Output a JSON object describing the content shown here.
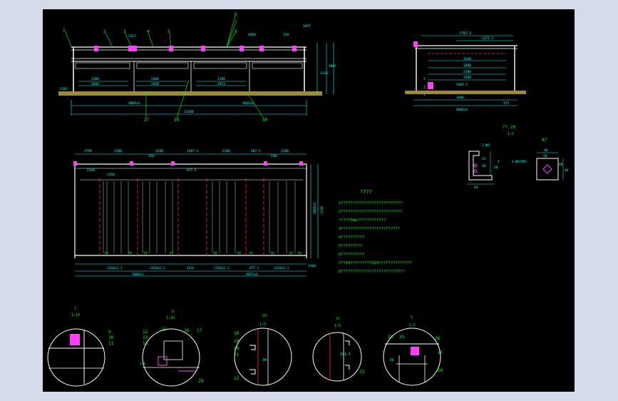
{
  "colors": {
    "background": "#d6dbe9",
    "canvas": "#000000",
    "structure": "#ffffff",
    "dimension": "#00ffff",
    "text_green": "#00ff00",
    "leader": "#00ff00",
    "hatch": "#9c8a3c",
    "red": "#ff3030",
    "magenta": "#ff40ff",
    "yellow": "#ffff00"
  },
  "elevation": {
    "balloons": [
      "1",
      "2",
      "3",
      "4",
      "5",
      "6",
      "7",
      "8"
    ],
    "bottom_callouts": [
      "27",
      "30",
      "30"
    ],
    "dims": [
      "2300",
      "2048",
      "2300",
      "2048",
      "3183",
      "2280",
      "2973",
      "9089±3",
      "13200",
      "9609±3",
      "3120",
      "4867",
      "1997",
      "158",
      "3127",
      "9680"
    ]
  },
  "side_view": {
    "dims": [
      "5707.5",
      "2272.5",
      "3630",
      "3880",
      "3190",
      "7690",
      "5684.5",
      "3680",
      "175",
      "9606±3"
    ],
    "callouts": [
      "2",
      "3",
      "1"
    ]
  },
  "plan": {
    "top_dims": [
      "1799",
      "2280",
      "150",
      "2280",
      "1507.5",
      "2280",
      "887.5",
      "530",
      "2280"
    ],
    "inner_dims": [
      "2346",
      "1350",
      "877.5"
    ],
    "bottom_dims": [
      "2310±1.5",
      "2310±1.5",
      "1542",
      "2310±1.5",
      "877.5",
      "2310±1.5"
    ],
    "overall_dims": [
      "7000±3",
      "9925±3",
      "1360"
    ],
    "side_dims": [
      "3060±3",
      "3230"
    ],
    "panel_labels": [
      "60",
      "60",
      "60",
      "60",
      "60",
      "60",
      "60",
      "60",
      "60",
      "60"
    ]
  },
  "notes": {
    "title": "????",
    "lines": [
      "1??????????????????????????",
      "2??????????????????????????",
      "   ?????3mm????????????",
      "3?????????????????????????",
      "4??????????",
      "5?????????",
      "6??????????",
      "7??16?????????Q29??????????????",
      "8???????????????????????????"
    ]
  },
  "details": {
    "bracket": {
      "title": "?? 29",
      "scale": "1:2",
      "dims": [
        "2-Φ9",
        "25",
        "30",
        "50",
        "44",
        "4"
      ]
    },
    "block": {
      "title": "A7",
      "dims": [
        "40",
        "20",
        "40",
        "40",
        "4-Φ8(M8)"
      ]
    },
    "circles": [
      {
        "label": "I",
        "scale": "1:10",
        "callouts": [
          "9",
          "10",
          "11"
        ]
      },
      {
        "label": "II",
        "scale": "1:10",
        "callouts": [
          "12",
          "13",
          "14",
          "15",
          "16",
          "17",
          "29",
          "178"
        ]
      },
      {
        "label": "III",
        "scale": "1:5",
        "callouts": [
          "18",
          "19",
          "20",
          "21",
          "22",
          "34"
        ]
      },
      {
        "label": "IV",
        "scale": "1:5",
        "callouts": [
          "101.5",
          "23"
        ]
      },
      {
        "label": "V",
        "scale": "1:5",
        "callouts": [
          "24",
          "25",
          "26",
          "27",
          "28",
          "60"
        ]
      }
    ]
  }
}
